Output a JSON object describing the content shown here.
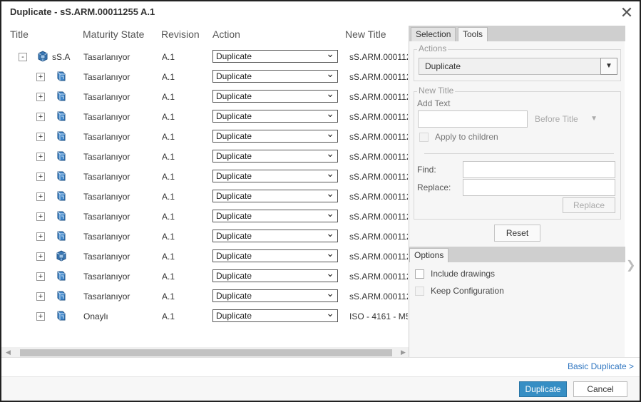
{
  "dialog": {
    "title": "Duplicate - sS.ARM.00011255 A.1",
    "close_glyph": "✕"
  },
  "grid": {
    "columns": [
      "Title",
      "Maturity State",
      "Revision",
      "Action",
      "New Title"
    ],
    "rows": [
      {
        "expander": "-",
        "title": "sS.A",
        "icon": "assembly-icon",
        "state": "Tasarlanıyor",
        "revision": "A.1",
        "action": "Duplicate",
        "new_title": "sS.ARM.000112"
      },
      {
        "expander": "+",
        "title": "",
        "icon": "part-icon",
        "state": "Tasarlanıyor",
        "revision": "A.1",
        "action": "Duplicate",
        "new_title": "sS.ARM.000112"
      },
      {
        "expander": "+",
        "title": "",
        "icon": "part-icon",
        "state": "Tasarlanıyor",
        "revision": "A.1",
        "action": "Duplicate",
        "new_title": "sS.ARM.000112"
      },
      {
        "expander": "+",
        "title": "",
        "icon": "part-icon",
        "state": "Tasarlanıyor",
        "revision": "A.1",
        "action": "Duplicate",
        "new_title": "sS.ARM.000112"
      },
      {
        "expander": "+",
        "title": "",
        "icon": "part-icon",
        "state": "Tasarlanıyor",
        "revision": "A.1",
        "action": "Duplicate",
        "new_title": "sS.ARM.000112"
      },
      {
        "expander": "+",
        "title": "",
        "icon": "part-icon",
        "state": "Tasarlanıyor",
        "revision": "A.1",
        "action": "Duplicate",
        "new_title": "sS.ARM.000112"
      },
      {
        "expander": "+",
        "title": "",
        "icon": "part-icon",
        "state": "Tasarlanıyor",
        "revision": "A.1",
        "action": "Duplicate",
        "new_title": "sS.ARM.000112"
      },
      {
        "expander": "+",
        "title": "",
        "icon": "part-icon",
        "state": "Tasarlanıyor",
        "revision": "A.1",
        "action": "Duplicate",
        "new_title": "sS.ARM.000112"
      },
      {
        "expander": "+",
        "title": "",
        "icon": "part-icon",
        "state": "Tasarlanıyor",
        "revision": "A.1",
        "action": "Duplicate",
        "new_title": "sS.ARM.000112"
      },
      {
        "expander": "+",
        "title": "",
        "icon": "part-icon",
        "state": "Tasarlanıyor",
        "revision": "A.1",
        "action": "Duplicate",
        "new_title": "sS.ARM.000112"
      },
      {
        "expander": "+",
        "title": "",
        "icon": "assembly-icon",
        "state": "Tasarlanıyor",
        "revision": "A.1",
        "action": "Duplicate",
        "new_title": "sS.ARM.000112"
      },
      {
        "expander": "+",
        "title": "",
        "icon": "part-icon",
        "state": "Tasarlanıyor",
        "revision": "A.1",
        "action": "Duplicate",
        "new_title": "sS.ARM.000112"
      },
      {
        "expander": "+",
        "title": "",
        "icon": "part-icon",
        "state": "Tasarlanıyor",
        "revision": "A.1",
        "action": "Duplicate",
        "new_title": "sS.ARM.000112"
      },
      {
        "expander": "+",
        "title": "",
        "icon": "part-icon",
        "state": "Onaylı",
        "revision": "A.1",
        "action": "Duplicate",
        "new_title": "ISO - 4161 - M5"
      }
    ]
  },
  "panel": {
    "tabs": [
      "Selection",
      "Tools"
    ],
    "active_tab": "Tools",
    "actions_legend": "Actions",
    "actions_value": "Duplicate",
    "new_title_legend": "New Title",
    "add_text_label": "Add Text",
    "add_text_value": "",
    "position_value": "Before Title",
    "apply_children_label": "Apply to children",
    "find_label": "Find:",
    "replace_label": "Replace:",
    "replace_button": "Replace",
    "reset_button": "Reset",
    "options_tab": "Options",
    "include_drawings_label": "Include drawings",
    "keep_configuration_label": "Keep Configuration"
  },
  "footer": {
    "basic_duplicate_link": "Basic Duplicate >",
    "duplicate_button": "Duplicate",
    "cancel_button": "Cancel"
  },
  "colors": {
    "primary": "#368ec4",
    "link": "#2e75c0",
    "panel_bg": "#f6f6f6",
    "tabbar_bg": "#cfcfcf"
  }
}
